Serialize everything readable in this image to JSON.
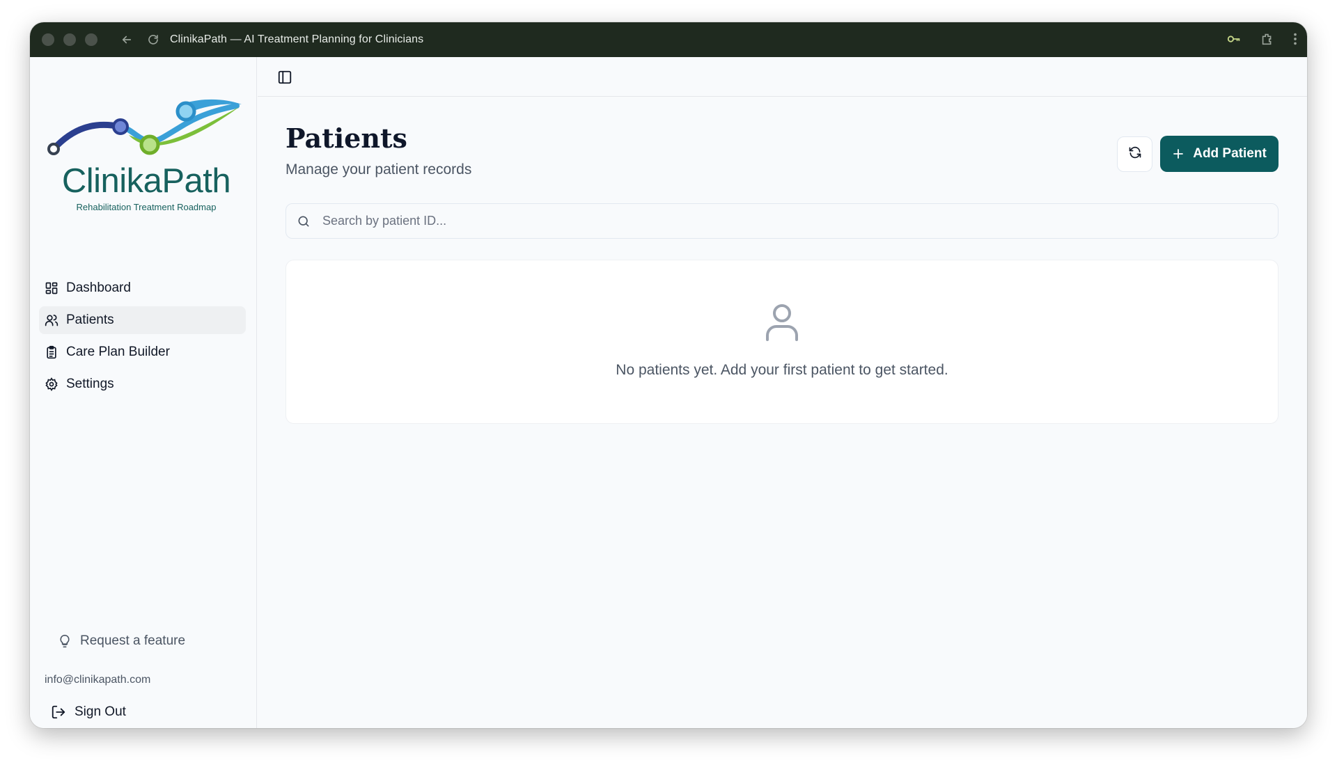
{
  "browser": {
    "title": "ClinikaPath — AI Treatment Planning for Clinicians"
  },
  "sidebar": {
    "logo_text": "ClinikaPath",
    "logo_tagline": "Rehabilitation Treatment Roadmap",
    "nav": [
      {
        "label": "Dashboard",
        "icon": "dashboard-icon"
      },
      {
        "label": "Patients",
        "icon": "users-icon",
        "active": true
      },
      {
        "label": "Care Plan Builder",
        "icon": "clipboard-icon"
      },
      {
        "label": "Settings",
        "icon": "gear-icon"
      }
    ],
    "feature_request": "Request a feature",
    "email": "info@clinikapath.com",
    "sign_out": "Sign Out"
  },
  "main": {
    "title": "Patients",
    "subtitle": "Manage your patient records",
    "add_button": "Add Patient",
    "search_placeholder": "Search by patient ID...",
    "empty_message": "No patients yet. Add your first patient to get started."
  },
  "colors": {
    "brand": "#0c5b5e",
    "titlebar": "#1f2a1f",
    "logo_text": "#17615e"
  }
}
